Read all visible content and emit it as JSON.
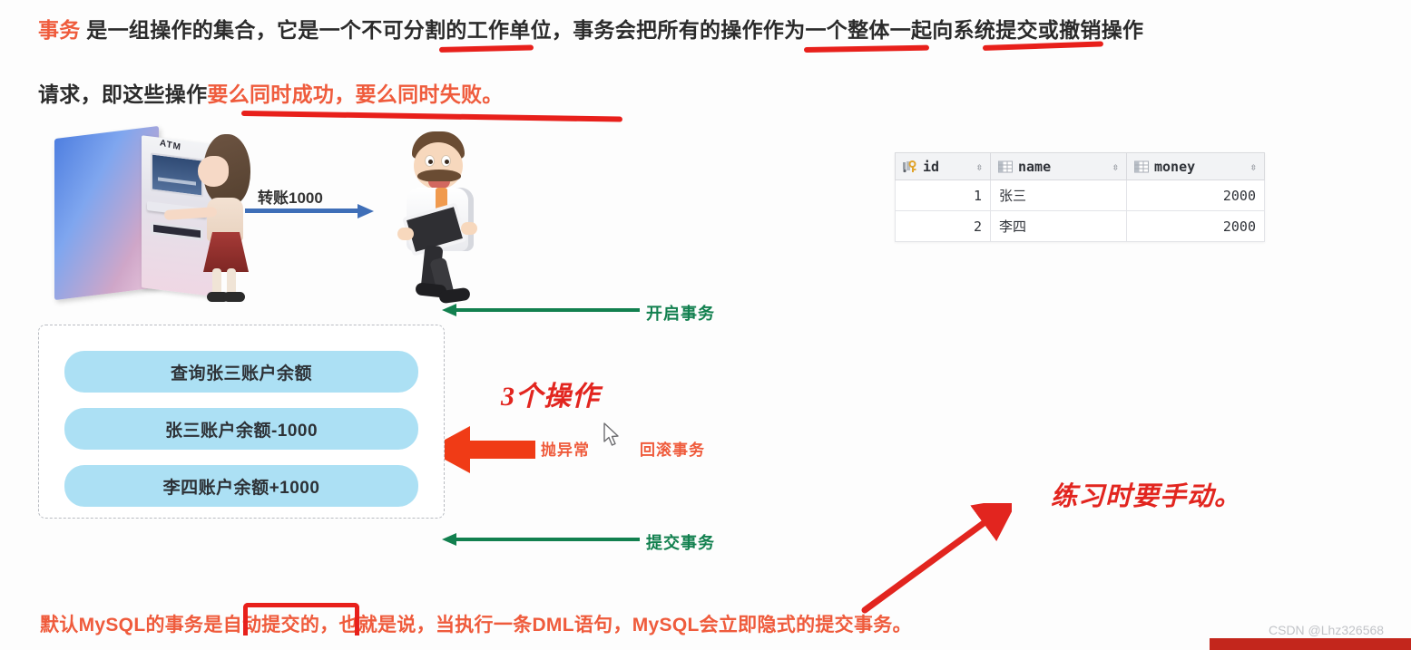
{
  "paragraph": {
    "line1_pre": "事务",
    "line1_rest": " 是一组操作的集合，它是一个不可分割的工作单位，事务会把所有的操作作为一个整体一起向系统提交或撤销操作",
    "line2_pre": "请求，即这些操作",
    "line2_hl": "要么同时成功，要么同时失败。"
  },
  "illustration": {
    "atm_label": "ATM",
    "transfer_label": "转账1000"
  },
  "flow": {
    "open_label": "开启事务",
    "commit_label": "提交事务",
    "throw_label": "抛异常",
    "rollback_label": "回滚事务"
  },
  "operations": {
    "items": [
      "查询张三账户余额",
      "张三账户余额-1000",
      "李四账户余额+1000"
    ]
  },
  "annotations": {
    "three_ops": "3个操作",
    "manual_note": "练习时要手动。"
  },
  "table": {
    "columns": [
      {
        "label": "id",
        "icon": "primary-key-icon",
        "sort": "⇳"
      },
      {
        "label": "name",
        "icon": "column-grid-icon",
        "sort": "⇳"
      },
      {
        "label": "money",
        "icon": "column-grid-icon",
        "sort": "⇳"
      }
    ],
    "rows": [
      {
        "id": "1",
        "name": "张三",
        "money": "2000"
      },
      {
        "id": "2",
        "name": "李四",
        "money": "2000"
      }
    ]
  },
  "bottom": {
    "text_a": "默认MySQL的事务是",
    "text_b": "自动提交的，",
    "text_c": "也就是说，当执行一条DML语句，MySQL会立即隐式的提交事务。"
  },
  "watermark": {
    "text": "CSDN @Lhz326568"
  },
  "colors": {
    "highlight_orange": "#ef5b3c",
    "pen_red": "#e8201b",
    "green_arrow": "#12804f",
    "blue_arrow": "#3f6fb8",
    "op_box_blue": "#ace0f4",
    "ribbon_red": "#c3261c"
  }
}
